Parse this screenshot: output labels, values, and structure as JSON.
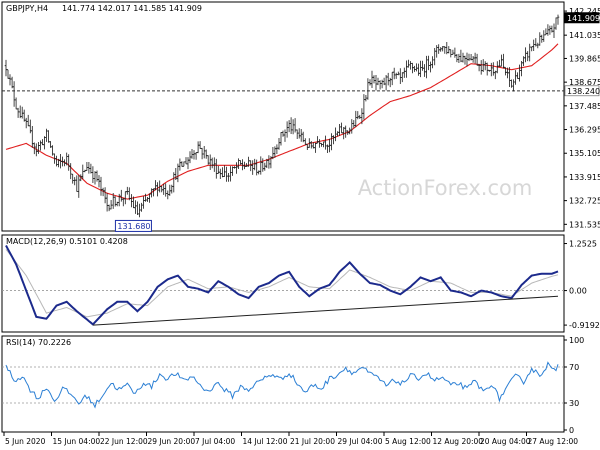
{
  "chart_data": [
    {
      "panel": "price",
      "type": "ohlc",
      "title": "GBPJPY,H4",
      "ohlc_readout": [
        "141.774",
        "142.017",
        "141.585",
        "141.909"
      ],
      "y_ticks": [
        "142.245",
        "141.035",
        "139.865",
        "138.675",
        "137.485",
        "136.295",
        "135.105",
        "133.915",
        "132.725",
        "131.535"
      ],
      "ylim": [
        131.3,
        142.6
      ],
      "current_price": {
        "label": "141.909",
        "value": 141.909
      },
      "horizontal_line": {
        "label": "138.240",
        "value": 138.24
      },
      "low_marker": {
        "label": "131.680",
        "value": 131.68
      },
      "watermark": "ActionForex.com",
      "x_ticks": [
        "5 Jun 2020",
        "15 Jun 04:00",
        "22 Jun 12:00",
        "29 Jun 20:00",
        "7 Jul 04:00",
        "14 Jul 12:00",
        "21 Jul 20:00",
        "29 Jul 04:00",
        "5 Aug 12:00",
        "12 Aug 20:00",
        "20 Aug 04:00",
        "27 Aug 12:00"
      ],
      "price_path": [
        [
          0,
          139.5
        ],
        [
          5,
          137.5
        ],
        [
          10,
          136.5
        ],
        [
          15,
          135.3
        ],
        [
          20,
          136.0
        ],
        [
          25,
          134.5
        ],
        [
          30,
          134.8
        ],
        [
          35,
          133.4
        ],
        [
          40,
          134.5
        ],
        [
          45,
          133.8
        ],
        [
          50,
          132.5
        ],
        [
          55,
          132.8
        ],
        [
          60,
          133.0
        ],
        [
          65,
          132.1
        ],
        [
          70,
          132.8
        ],
        [
          75,
          133.5
        ],
        [
          80,
          133.2
        ],
        [
          85,
          134.3
        ],
        [
          90,
          134.8
        ],
        [
          95,
          135.5
        ],
        [
          100,
          134.8
        ],
        [
          105,
          134.2
        ],
        [
          110,
          134.0
        ],
        [
          115,
          134.5
        ],
        [
          120,
          134.5
        ],
        [
          125,
          134.3
        ],
        [
          130,
          134.8
        ],
        [
          135,
          135.8
        ],
        [
          140,
          136.5
        ],
        [
          145,
          136.0
        ],
        [
          150,
          135.4
        ],
        [
          155,
          135.8
        ],
        [
          160,
          135.6
        ],
        [
          165,
          136.2
        ],
        [
          170,
          136.3
        ],
        [
          175,
          137.0
        ],
        [
          180,
          138.8
        ],
        [
          185,
          138.4
        ],
        [
          190,
          139.0
        ],
        [
          195,
          138.8
        ],
        [
          200,
          139.5
        ],
        [
          205,
          139.2
        ],
        [
          210,
          139.8
        ],
        [
          215,
          140.5
        ],
        [
          220,
          140.2
        ],
        [
          225,
          139.9
        ],
        [
          230,
          140.0
        ],
        [
          235,
          139.5
        ],
        [
          240,
          139.3
        ],
        [
          245,
          139.6
        ],
        [
          250,
          138.5
        ],
        [
          255,
          139.5
        ],
        [
          260,
          140.5
        ],
        [
          265,
          140.8
        ],
        [
          270,
          141.3
        ],
        [
          273,
          141.909
        ]
      ],
      "ma_path": [
        [
          0,
          135.3
        ],
        [
          10,
          135.6
        ],
        [
          20,
          135.0
        ],
        [
          30,
          134.6
        ],
        [
          40,
          133.6
        ],
        [
          50,
          133.1
        ],
        [
          60,
          132.8
        ],
        [
          70,
          133.0
        ],
        [
          80,
          133.7
        ],
        [
          90,
          134.2
        ],
        [
          100,
          134.5
        ],
        [
          110,
          134.5
        ],
        [
          120,
          134.5
        ],
        [
          130,
          134.8
        ],
        [
          140,
          135.2
        ],
        [
          150,
          135.6
        ],
        [
          160,
          135.8
        ],
        [
          170,
          136.2
        ],
        [
          180,
          137.0
        ],
        [
          190,
          137.7
        ],
        [
          200,
          138.0
        ],
        [
          210,
          138.4
        ],
        [
          220,
          139.0
        ],
        [
          230,
          139.6
        ],
        [
          240,
          139.5
        ],
        [
          250,
          139.3
        ],
        [
          260,
          139.5
        ],
        [
          270,
          140.3
        ],
        [
          273,
          140.6
        ]
      ]
    },
    {
      "panel": "macd",
      "type": "line",
      "title": "MACD(12,26,9) 0.5101 0.4208",
      "y_ticks": [
        "1.2525",
        "0.00",
        "-0.9192"
      ],
      "ylim": [
        -1.05,
        1.4
      ],
      "zero_line": 0,
      "trendline": [
        [
          43,
          -0.92
        ],
        [
          273,
          -0.15
        ]
      ],
      "macd_path": [
        [
          0,
          1.2
        ],
        [
          5,
          0.7
        ],
        [
          10,
          0.0
        ],
        [
          15,
          -0.7
        ],
        [
          20,
          -0.75
        ],
        [
          25,
          -0.4
        ],
        [
          30,
          -0.3
        ],
        [
          35,
          -0.55
        ],
        [
          43,
          -0.9
        ],
        [
          50,
          -0.5
        ],
        [
          55,
          -0.3
        ],
        [
          60,
          -0.3
        ],
        [
          65,
          -0.55
        ],
        [
          70,
          -0.3
        ],
        [
          75,
          0.1
        ],
        [
          80,
          0.3
        ],
        [
          85,
          0.4
        ],
        [
          90,
          0.1
        ],
        [
          95,
          0.05
        ],
        [
          100,
          -0.05
        ],
        [
          105,
          0.25
        ],
        [
          110,
          0.1
        ],
        [
          115,
          -0.1
        ],
        [
          120,
          -0.2
        ],
        [
          125,
          0.1
        ],
        [
          130,
          0.2
        ],
        [
          135,
          0.4
        ],
        [
          140,
          0.5
        ],
        [
          145,
          0.1
        ],
        [
          150,
          -0.15
        ],
        [
          155,
          0.05
        ],
        [
          160,
          0.15
        ],
        [
          165,
          0.5
        ],
        [
          170,
          0.75
        ],
        [
          175,
          0.45
        ],
        [
          180,
          0.2
        ],
        [
          185,
          0.15
        ],
        [
          190,
          0.0
        ],
        [
          195,
          -0.1
        ],
        [
          200,
          0.1
        ],
        [
          205,
          0.35
        ],
        [
          210,
          0.25
        ],
        [
          215,
          0.35
        ],
        [
          220,
          0.0
        ],
        [
          225,
          -0.05
        ],
        [
          230,
          -0.15
        ],
        [
          235,
          0.0
        ],
        [
          240,
          -0.05
        ],
        [
          245,
          -0.15
        ],
        [
          250,
          -0.2
        ],
        [
          255,
          0.15
        ],
        [
          260,
          0.4
        ],
        [
          265,
          0.45
        ],
        [
          270,
          0.45
        ],
        [
          273,
          0.51
        ]
      ],
      "signal_path": [
        [
          0,
          1.1
        ],
        [
          10,
          0.4
        ],
        [
          20,
          -0.6
        ],
        [
          30,
          -0.45
        ],
        [
          40,
          -0.7
        ],
        [
          50,
          -0.6
        ],
        [
          60,
          -0.35
        ],
        [
          70,
          -0.4
        ],
        [
          80,
          0.1
        ],
        [
          90,
          0.3
        ],
        [
          100,
          0.05
        ],
        [
          110,
          0.1
        ],
        [
          120,
          -0.05
        ],
        [
          130,
          0.1
        ],
        [
          140,
          0.35
        ],
        [
          150,
          0.1
        ],
        [
          160,
          0.05
        ],
        [
          170,
          0.55
        ],
        [
          180,
          0.35
        ],
        [
          190,
          0.1
        ],
        [
          200,
          0.0
        ],
        [
          210,
          0.25
        ],
        [
          220,
          0.2
        ],
        [
          230,
          -0.05
        ],
        [
          240,
          -0.05
        ],
        [
          250,
          -0.15
        ],
        [
          260,
          0.2
        ],
        [
          270,
          0.38
        ],
        [
          273,
          0.42
        ]
      ]
    },
    {
      "panel": "rsi",
      "type": "line",
      "title": "RSI(14) 70.2226",
      "y_ticks": [
        "100",
        "70",
        "30",
        "0"
      ],
      "ylim": [
        0,
        100
      ],
      "levels": [
        70,
        30
      ],
      "rsi_path": [
        [
          0,
          72
        ],
        [
          4,
          55
        ],
        [
          8,
          60
        ],
        [
          12,
          45
        ],
        [
          16,
          35
        ],
        [
          20,
          48
        ],
        [
          24,
          32
        ],
        [
          28,
          46
        ],
        [
          32,
          40
        ],
        [
          36,
          30
        ],
        [
          40,
          38
        ],
        [
          44,
          27
        ],
        [
          48,
          40
        ],
        [
          52,
          52
        ],
        [
          56,
          45
        ],
        [
          60,
          50
        ],
        [
          64,
          40
        ],
        [
          68,
          53
        ],
        [
          72,
          48
        ],
        [
          76,
          62
        ],
        [
          80,
          57
        ],
        [
          84,
          63
        ],
        [
          88,
          54
        ],
        [
          92,
          60
        ],
        [
          96,
          50
        ],
        [
          100,
          42
        ],
        [
          104,
          53
        ],
        [
          108,
          45
        ],
        [
          112,
          38
        ],
        [
          116,
          48
        ],
        [
          120,
          45
        ],
        [
          124,
          52
        ],
        [
          128,
          58
        ],
        [
          132,
          62
        ],
        [
          136,
          56
        ],
        [
          140,
          64
        ],
        [
          144,
          52
        ],
        [
          148,
          42
        ],
        [
          152,
          50
        ],
        [
          156,
          46
        ],
        [
          160,
          57
        ],
        [
          164,
          62
        ],
        [
          168,
          69
        ],
        [
          172,
          63
        ],
        [
          176,
          70
        ],
        [
          180,
          62
        ],
        [
          184,
          58
        ],
        [
          188,
          49
        ],
        [
          192,
          55
        ],
        [
          196,
          52
        ],
        [
          200,
          60
        ],
        [
          204,
          58
        ],
        [
          208,
          63
        ],
        [
          212,
          55
        ],
        [
          216,
          58
        ],
        [
          220,
          49
        ],
        [
          224,
          52
        ],
        [
          228,
          45
        ],
        [
          232,
          55
        ],
        [
          236,
          42
        ],
        [
          240,
          52
        ],
        [
          244,
          35
        ],
        [
          248,
          48
        ],
        [
          252,
          60
        ],
        [
          256,
          54
        ],
        [
          260,
          68
        ],
        [
          264,
          61
        ],
        [
          268,
          73
        ],
        [
          272,
          64
        ],
        [
          273,
          70.22
        ]
      ]
    }
  ]
}
